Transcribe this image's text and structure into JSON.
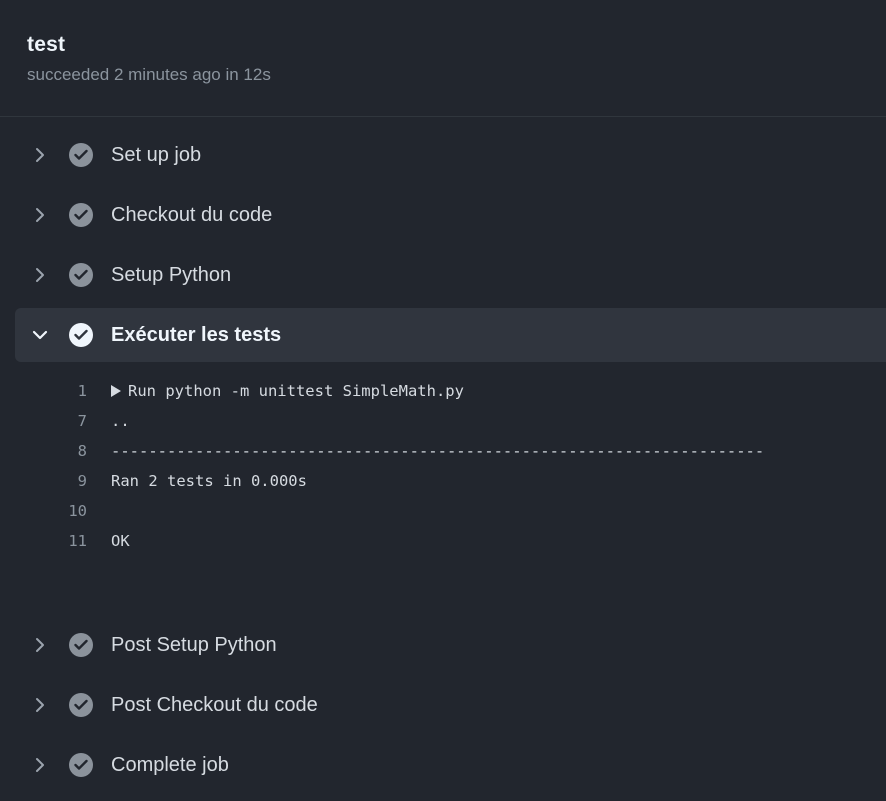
{
  "job": {
    "title": "test",
    "status": "succeeded 2 minutes ago in 12s"
  },
  "steps_before": [
    {
      "label": "Set up job"
    },
    {
      "label": "Checkout du code"
    },
    {
      "label": "Setup Python"
    }
  ],
  "expanded_step": {
    "label": "Exécuter les tests",
    "log": [
      {
        "num": "1",
        "text": "Run python -m unittest SimpleMath.py",
        "collapsible": true
      },
      {
        "num": "7",
        "text": ".."
      },
      {
        "num": "8",
        "text": "----------------------------------------------------------------------"
      },
      {
        "num": "9",
        "text": "Ran 2 tests in 0.000s"
      },
      {
        "num": "10",
        "text": ""
      },
      {
        "num": "11",
        "text": "OK"
      }
    ]
  },
  "steps_after": [
    {
      "label": "Post Setup Python"
    },
    {
      "label": "Post Checkout du code"
    },
    {
      "label": "Complete job"
    }
  ],
  "icons": {
    "collapsed": "chevron-right-icon",
    "expanded": "chevron-down-icon",
    "status": "check-circle-icon"
  },
  "colors": {
    "background": "#22262e",
    "expanded_row": "#30353e",
    "check_muted": "#8b929b",
    "check_active": "#f0f6fc",
    "line_number": "#8b949e"
  }
}
